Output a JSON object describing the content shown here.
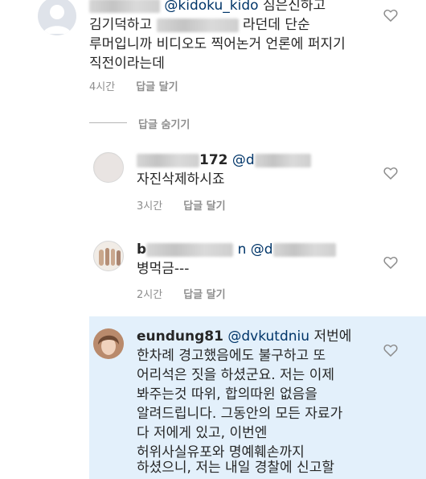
{
  "comments": [
    {
      "mention": "@kidoku_kido",
      "lines": [
        "심은신하고",
        "김기덕하고",
        "라던데 단순",
        "루머입니까 비디오도 찍어논거 언론에 퍼지기",
        "직전이라는데"
      ],
      "time": "4시간",
      "reply_label": "답글 달기"
    },
    {
      "handle_visible": "172",
      "mention": "@d",
      "text": "자진삭제하시죠",
      "time": "3시간",
      "reply_label": "답글 달기"
    },
    {
      "handle_visible": "b",
      "mention_visible": "n @d",
      "text": "병먹금---",
      "time": "2시간",
      "reply_label": "답글 달기"
    },
    {
      "username": "eundung81",
      "mention": "@dvkutdniu",
      "lines": [
        "저번에",
        "한차례 경고했음에도 불구하고 또",
        "어리석은 짓을 하셨군요. 저는 이제",
        "봐주는것 따위, 합의따윈 없음을",
        "알려드립니다. 그동안의 모든 자료가",
        "다 저에게 있고, 이번엔",
        "허위사실유포와 명예훼손까지",
        "하셨으니, 저는 내일 경찰에 신고할"
      ]
    }
  ],
  "hide_replies_label": "답글 숨기기",
  "icons": {
    "like": "heart-outline-icon"
  },
  "colors": {
    "highlight": "#e3f0fb",
    "meta": "#8e8e8e",
    "mention": "#003569"
  }
}
